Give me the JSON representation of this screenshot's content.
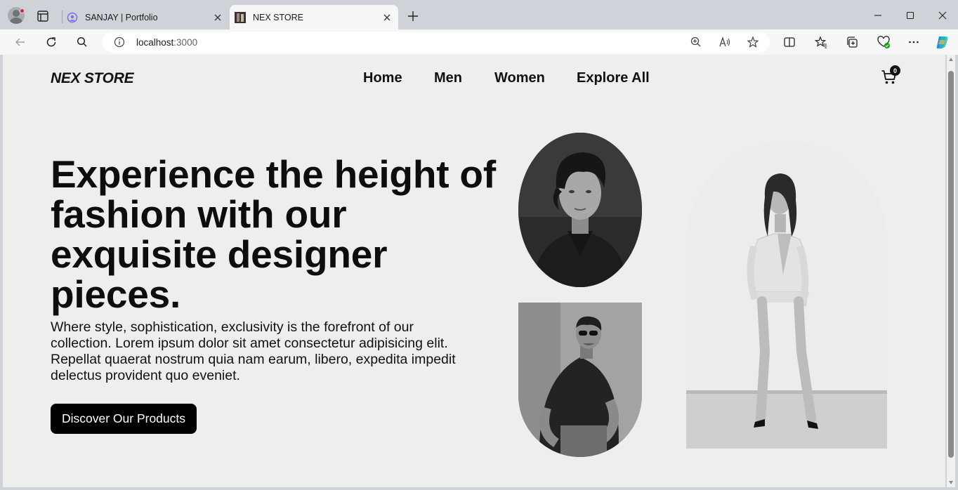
{
  "browser": {
    "tabs": [
      {
        "title": "SANJAY | Portfolio",
        "active": false,
        "icon": "portfolio-favicon-icon"
      },
      {
        "title": "NEX STORE",
        "active": true,
        "icon": "nex-store-favicon-icon"
      }
    ],
    "address": {
      "host": "localhost",
      "port": ":3000"
    },
    "icons": [
      "back-icon",
      "refresh-icon",
      "search-icon",
      "info-icon",
      "zoom-icon",
      "read-aloud-icon",
      "favorite-star-icon",
      "split-screen-icon",
      "favorites-icon",
      "collections-icon",
      "browser-essentials-icon",
      "more-icon",
      "copilot-icon"
    ]
  },
  "site": {
    "brand": "NEX STORE",
    "nav": [
      "Home",
      "Men",
      "Women",
      "Explore All"
    ],
    "cart": {
      "count": "0"
    },
    "hero": {
      "title": "Experience the height of fashion with our exquisite designer pieces.",
      "description": "Where style, sophistication, exclusivity is the forefront of our collection. Lorem ipsum dolor sit amet consectetur adipisicing elit. Repellat quaerat nostrum quia nam earum, libero, expedita impedit delectus provident quo eveniet.",
      "cta": "Discover Our Products"
    }
  },
  "colors": {
    "page_background": "#eeeeee",
    "text": "#0d0d0d",
    "button_background": "#000000",
    "button_text": "#ffffff",
    "browser_frame": "#cfd3d8"
  }
}
